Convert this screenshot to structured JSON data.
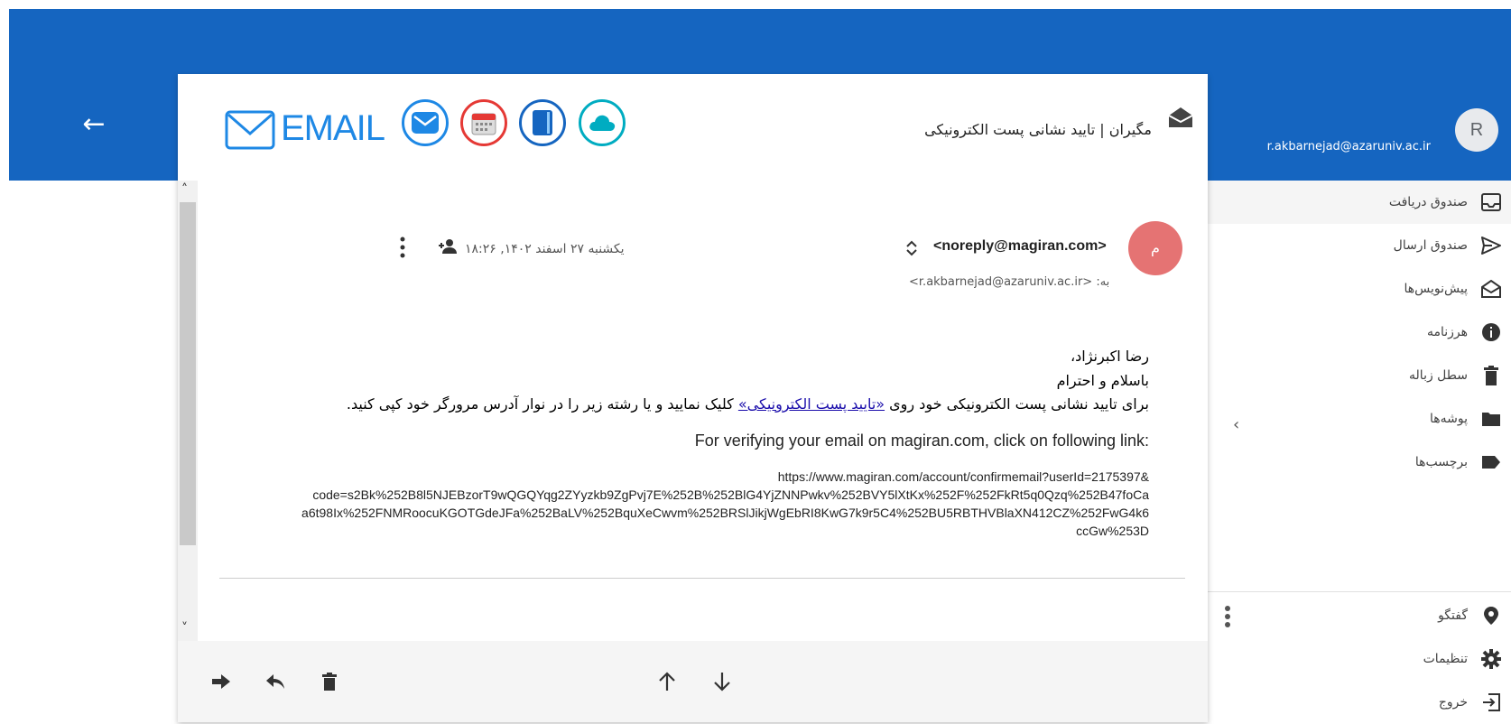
{
  "header": {
    "user_email": "r.akbarnejad@azaruniv.ac.ir",
    "avatar_letter": "R",
    "back_label": "←"
  },
  "sidebar": {
    "items": [
      {
        "label": "صندوق دریافت",
        "icon": "inbox-icon"
      },
      {
        "label": "صندوق ارسال",
        "icon": "send-icon"
      },
      {
        "label": "پیش‌نویس‌ها",
        "icon": "drafts-icon"
      },
      {
        "label": "هرزنامه",
        "icon": "info-icon"
      },
      {
        "label": "سطل زباله",
        "icon": "trash-icon"
      },
      {
        "label": "پوشه‌ها",
        "icon": "folder-icon"
      },
      {
        "label": "برچسب‌ها",
        "icon": "label-icon"
      }
    ],
    "bottom_items": [
      {
        "label": "گفتگو",
        "icon": "location-icon"
      },
      {
        "label": "تنظیمات",
        "icon": "gear-icon"
      },
      {
        "label": "خروج",
        "icon": "logout-icon"
      }
    ]
  },
  "email": {
    "logo_text": "EMAIL",
    "subject": "مگیران | تایید نشانی پست الکترونیکی",
    "sender_initial": "م",
    "sender_email": "<noreply@magiran.com>",
    "to_line": "به: <r.akbarnejad@azaruniv.ac.ir>",
    "date": "یکشنبه ۲۷ اسفند ۱۴۰۲, ۱۸:۲۶",
    "body": {
      "greeting": "رضا اکبرنژاد،",
      "salutation": "باسلام و احترام",
      "instruction_before": "برای تایید نشانی پست الکترونیکی خود روی ",
      "link_text": "«تایید پست الکترونیکی»",
      "instruction_after": " کلیک نمایید و یا رشته زیر را در نوار آدرس مرورگر خود کپی کنید.",
      "english_line": "For verifying your email on magiran.com, click on following link:",
      "url_lines": [
        "https://www.magiran.com/account/confirmemail?userId=2175397&",
        "code=s2Bk%252B8l5NJEBzorT9wQGQYqg2ZYyzkb9ZgPvj7E%252B%252BlG4YjZNNPwkv%252BVY5lXtKx%252F%252FkRt5q0Qzq%252B47foCa",
        "a6t98Ix%252FNMRoocuKGOTGdeJFa%252BaLV%252BquXeCwvm%252BRSlJikjWgEbRI8KwG7k9r5C4%252BU5RBTHVBlaXN412CZ%252FwG4k6",
        "ccGw%253D"
      ]
    }
  },
  "colors": {
    "topbar": "#1565c0",
    "sender_avatar": "#e57373",
    "link": "#1a0dab"
  }
}
